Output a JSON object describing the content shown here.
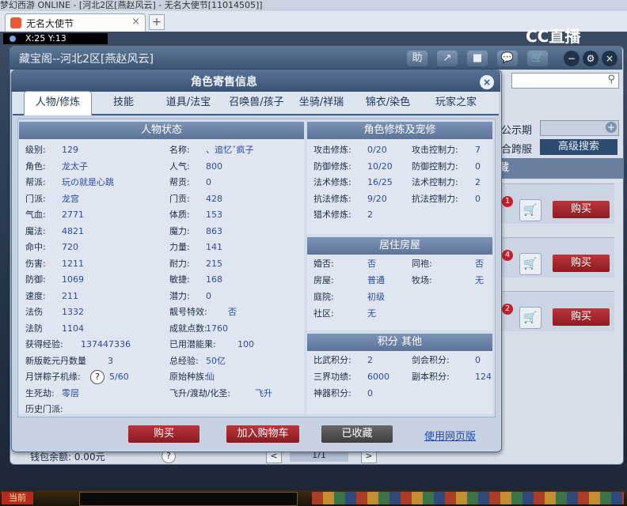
{
  "browser": {
    "os_title": "梦幻西游 ONLINE - [河北2区[燕赵风云] - 无名大使节[11014505]]",
    "tab_label": "无名大使节",
    "tab_close": "×",
    "new_tab": "+",
    "coords": "X:25 Y:13",
    "cc_logo": "CC直播"
  },
  "background_panel": {
    "title": "藏宝阁--河北2区[燕赵风云]",
    "header_buttons": [
      "助",
      "↗",
      "■",
      "💬",
      "🛒"
    ],
    "window_controls": [
      "−",
      "⚙",
      "×"
    ],
    "announce_label": "公示期",
    "cross_label": "合跨服",
    "advanced_search": "高级搜索",
    "tab_strip": "藏",
    "badges": [
      "1",
      "4",
      "2"
    ],
    "buy_label": "购买",
    "wallet": "钱包余额: 0.00元",
    "help": "?",
    "pager": {
      "prev": "<",
      "text": "1/1",
      "next": ">"
    }
  },
  "gamebar": {
    "now": "当前"
  },
  "modal": {
    "title": "角色寄售信息",
    "close": "×",
    "tabs": [
      "人物/修炼",
      "技能",
      "道具/法宝",
      "召唤兽/孩子",
      "坐骑/祥瑞",
      "锦衣/染色",
      "玩家之家"
    ],
    "active_tab": 0,
    "sections": {
      "status": {
        "title": "人物状态",
        "left": [
          {
            "label": "级别:",
            "value": "129"
          },
          {
            "label": "角色:",
            "value": "龙太子"
          },
          {
            "label": "帮派:",
            "value": "玩の就是心跳"
          },
          {
            "label": "门派:",
            "value": "龙宫"
          },
          {
            "label": "气血:",
            "value": "2771"
          },
          {
            "label": "魔法:",
            "value": "4821"
          },
          {
            "label": "命中:",
            "value": "720"
          },
          {
            "label": "伤害:",
            "value": "1211"
          },
          {
            "label": "防御:",
            "value": "1069"
          },
          {
            "label": "速度:",
            "value": "211"
          },
          {
            "label": "法伤",
            "value": "1332"
          },
          {
            "label": "法防",
            "value": "1104"
          },
          {
            "label": "获得经验:",
            "value": "137447336"
          },
          {
            "label": "新版乾元丹数量",
            "value": "3"
          },
          {
            "label": "月饼粽子机缘:",
            "value": "5/60"
          },
          {
            "label": "生死劫:",
            "value": "零层"
          },
          {
            "label": "历史门派:",
            "value": ""
          }
        ],
        "right": [
          {
            "label": "名称:",
            "value": "、追忆ˇ疯子"
          },
          {
            "label": "人气:",
            "value": "800"
          },
          {
            "label": "帮贡:",
            "value": "0"
          },
          {
            "label": "门贡:",
            "value": "428"
          },
          {
            "label": "体质:",
            "value": "153"
          },
          {
            "label": "魔力:",
            "value": "863"
          },
          {
            "label": "力量:",
            "value": "141"
          },
          {
            "label": "耐力:",
            "value": "215"
          },
          {
            "label": "敏捷:",
            "value": "168"
          },
          {
            "label": "潜力:",
            "value": "0"
          },
          {
            "label": "靓号特效:",
            "value": "否"
          },
          {
            "label": "成就点数:",
            "value": "1760"
          },
          {
            "label": "已用潜能果:",
            "value": "100"
          },
          {
            "label": "总经验:",
            "value": "50亿"
          },
          {
            "label": "原始种族:",
            "value": "仙"
          },
          {
            "label": "飞升/渡劫/化圣:",
            "value": "飞升"
          }
        ],
        "help": "?"
      },
      "cultivation": {
        "title": "角色修炼及宠修",
        "rows": [
          {
            "l": "攻击修炼:",
            "lv": "0/20",
            "r": "攻击控制力:",
            "rv": "7"
          },
          {
            "l": "防御修炼:",
            "lv": "10/20",
            "r": "防御控制力:",
            "rv": "0"
          },
          {
            "l": "法术修炼:",
            "lv": "16/25",
            "r": "法术控制力:",
            "rv": "2"
          },
          {
            "l": "抗法修炼:",
            "lv": "9/20",
            "r": "抗法控制力:",
            "rv": "0"
          },
          {
            "l": "猎术修炼:",
            "lv": "2",
            "r": "",
            "rv": ""
          }
        ]
      },
      "house": {
        "title": "居住房屋",
        "rows": [
          {
            "l": "婚否:",
            "lv": "否",
            "r": "同袍:",
            "rv": "否"
          },
          {
            "l": "房屋:",
            "lv": "普通",
            "r": "牧场:",
            "rv": "无"
          },
          {
            "l": "庭院:",
            "lv": "初级",
            "r": "",
            "rv": ""
          },
          {
            "l": "社区:",
            "lv": "无",
            "r": "",
            "rv": ""
          }
        ]
      },
      "points": {
        "title": "积分 其他",
        "rows": [
          {
            "l": "比武积分:",
            "lv": "2",
            "r": "剑会积分:",
            "rv": "0"
          },
          {
            "l": "三界功绩:",
            "lv": "6000",
            "r": "副本积分:",
            "rv": "124"
          },
          {
            "l": "神器积分:",
            "lv": "0",
            "r": "",
            "rv": ""
          }
        ]
      }
    },
    "actions": {
      "buy": "购买",
      "add_cart": "加入购物车",
      "favorited": "已收藏",
      "web_version": "使用网页版"
    }
  }
}
